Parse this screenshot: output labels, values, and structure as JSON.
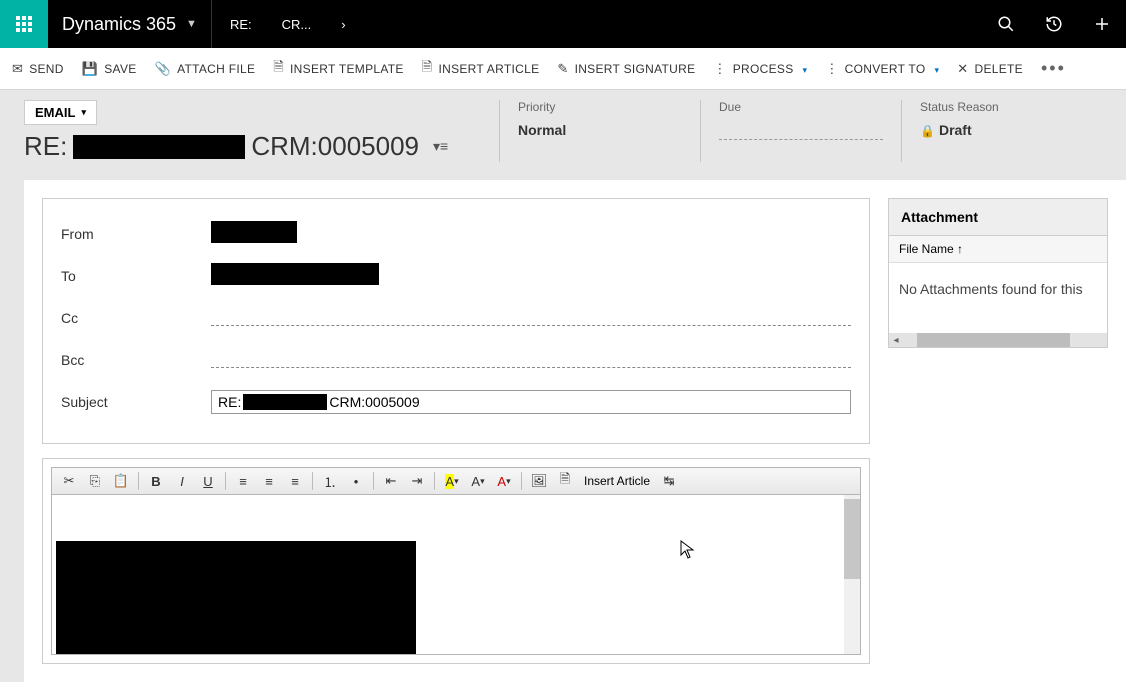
{
  "topbar": {
    "brand": "Dynamics 365",
    "crumb_prefix": "RE:",
    "crumb_suffix": "CR..."
  },
  "commands": {
    "send": "SEND",
    "save": "SAVE",
    "attach": "ATTACH FILE",
    "template": "INSERT TEMPLATE",
    "article": "INSERT ARTICLE",
    "signature": "INSERT SIGNATURE",
    "process": "PROCESS",
    "convert": "CONVERT TO",
    "delete": "DELETE"
  },
  "header": {
    "entity": "EMAIL",
    "title_prefix": "RE:",
    "title_suffix": "CRM:0005009",
    "priority_label": "Priority",
    "priority_value": "Normal",
    "due_label": "Due",
    "status_label": "Status Reason",
    "status_value": "Draft"
  },
  "form": {
    "from": "From",
    "to": "To",
    "cc": "Cc",
    "bcc": "Bcc",
    "subject": "Subject",
    "subject_prefix": "RE:",
    "subject_suffix": "CRM:0005009"
  },
  "editor": {
    "insert_article": "Insert Article"
  },
  "attachment": {
    "title": "Attachment",
    "col": "File Name ↑",
    "empty": "No Attachments found for this"
  }
}
